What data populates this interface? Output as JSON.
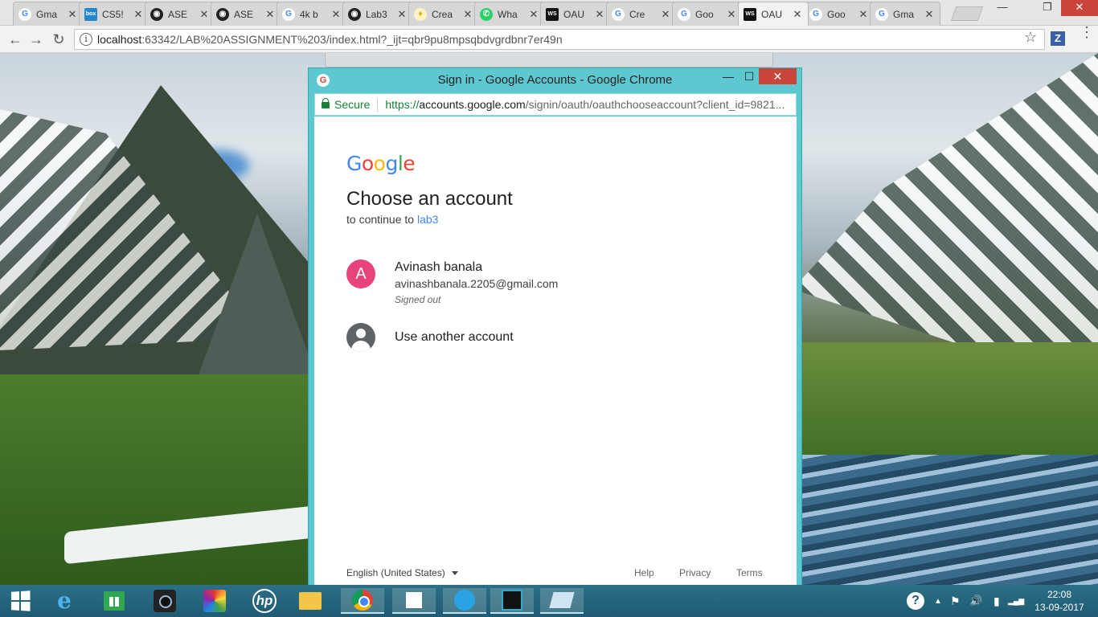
{
  "browser": {
    "tabs": [
      {
        "title": "Gma",
        "favicon": "google-icon",
        "color": "#ffffff",
        "fg": "#4285f4",
        "letter": "G"
      },
      {
        "title": "CS5!",
        "favicon": "box-icon",
        "color": "#2486cf",
        "fg": "#ffffff",
        "letter": "box"
      },
      {
        "title": "ASE",
        "favicon": "github-icon",
        "color": "#222222",
        "fg": "#ffffff",
        "letter": "◉"
      },
      {
        "title": "ASE",
        "favicon": "github-icon",
        "color": "#222222",
        "fg": "#ffffff",
        "letter": "◉"
      },
      {
        "title": "4k b",
        "favicon": "google-icon",
        "color": "#ffffff",
        "fg": "#4285f4",
        "letter": "G"
      },
      {
        "title": "Lab3",
        "favicon": "github-icon",
        "color": "#222222",
        "fg": "#ffffff",
        "letter": "◉"
      },
      {
        "title": "Crea",
        "favicon": "lightbulb-icon",
        "color": "#fff3c4",
        "fg": "#e0a800",
        "letter": "♦"
      },
      {
        "title": "Wha",
        "favicon": "whatsapp-icon",
        "color": "#25d366",
        "fg": "#ffffff",
        "letter": "✆"
      },
      {
        "title": "OAU",
        "favicon": "webstorm-icon",
        "color": "#111111",
        "fg": "#ffffff",
        "letter": "WS"
      },
      {
        "title": "Cre",
        "favicon": "google-icon",
        "color": "#ffffff",
        "fg": "#4285f4",
        "letter": "G"
      },
      {
        "title": "Goo",
        "favicon": "google-icon",
        "color": "#ffffff",
        "fg": "#4285f4",
        "letter": "G"
      },
      {
        "title": "OAU",
        "favicon": "webstorm-icon",
        "color": "#111111",
        "fg": "#ffffff",
        "letter": "WS",
        "active": true
      },
      {
        "title": "Goo",
        "favicon": "google-icon",
        "color": "#ffffff",
        "fg": "#4285f4",
        "letter": "G"
      },
      {
        "title": "Gma",
        "favicon": "google-icon",
        "color": "#ffffff",
        "fg": "#4285f4",
        "letter": "G"
      }
    ],
    "url_host": "localhost",
    "url_rest": ":63342/LAB%20ASSIGNMENT%203/index.html?_ijt=qbr9pu8mpsqbdvgrdbnr7er49n",
    "window_controls": {
      "minimize": "—",
      "maximize": "❐",
      "close": "✕"
    },
    "nav": {
      "back": "←",
      "forward": "→",
      "reload": "↻",
      "info": "i",
      "star": "☆",
      "ext": "Z",
      "menu": "⋮"
    }
  },
  "popup": {
    "title": "Sign in - Google Accounts - Google Chrome",
    "favicon_letter": "G",
    "controls": {
      "minimize": "—",
      "maximize": "☐",
      "close": "✕"
    },
    "secure_label": "Secure",
    "url_https": "https://",
    "url_host": "accounts.google.com",
    "url_path": "/signin/oauth/oauthchooseaccount?client_id=9821...",
    "page": {
      "logo_letters": [
        {
          "ch": "G",
          "color": "#4285f4"
        },
        {
          "ch": "o",
          "color": "#ea4335"
        },
        {
          "ch": "o",
          "color": "#fbbc05"
        },
        {
          "ch": "g",
          "color": "#4285f4"
        },
        {
          "ch": "l",
          "color": "#34a853"
        },
        {
          "ch": "e",
          "color": "#ea4335"
        }
      ],
      "heading": "Choose an account",
      "subtitle_prefix": "to continue to ",
      "app_name": "lab3",
      "account": {
        "avatar_letter": "A",
        "avatar_color": "#e8437b",
        "name": "Avinash banala",
        "email": "avinashbanala.2205@gmail.com",
        "status": "Signed out"
      },
      "another_account": "Use another account",
      "footer": {
        "language": "English (United States)",
        "help": "Help",
        "privacy": "Privacy",
        "terms": "Terms"
      }
    }
  },
  "taskbar": {
    "ie_glyph": "e",
    "hp_label": "hp",
    "help_glyph": "?",
    "tray_arrow": "▲",
    "tray_flag": "⚑",
    "tray_volume": "🔊",
    "tray_battery": "▮",
    "tray_signal": "▂▄▆",
    "clock_time": "22:08",
    "clock_date": "13-09-2017"
  }
}
